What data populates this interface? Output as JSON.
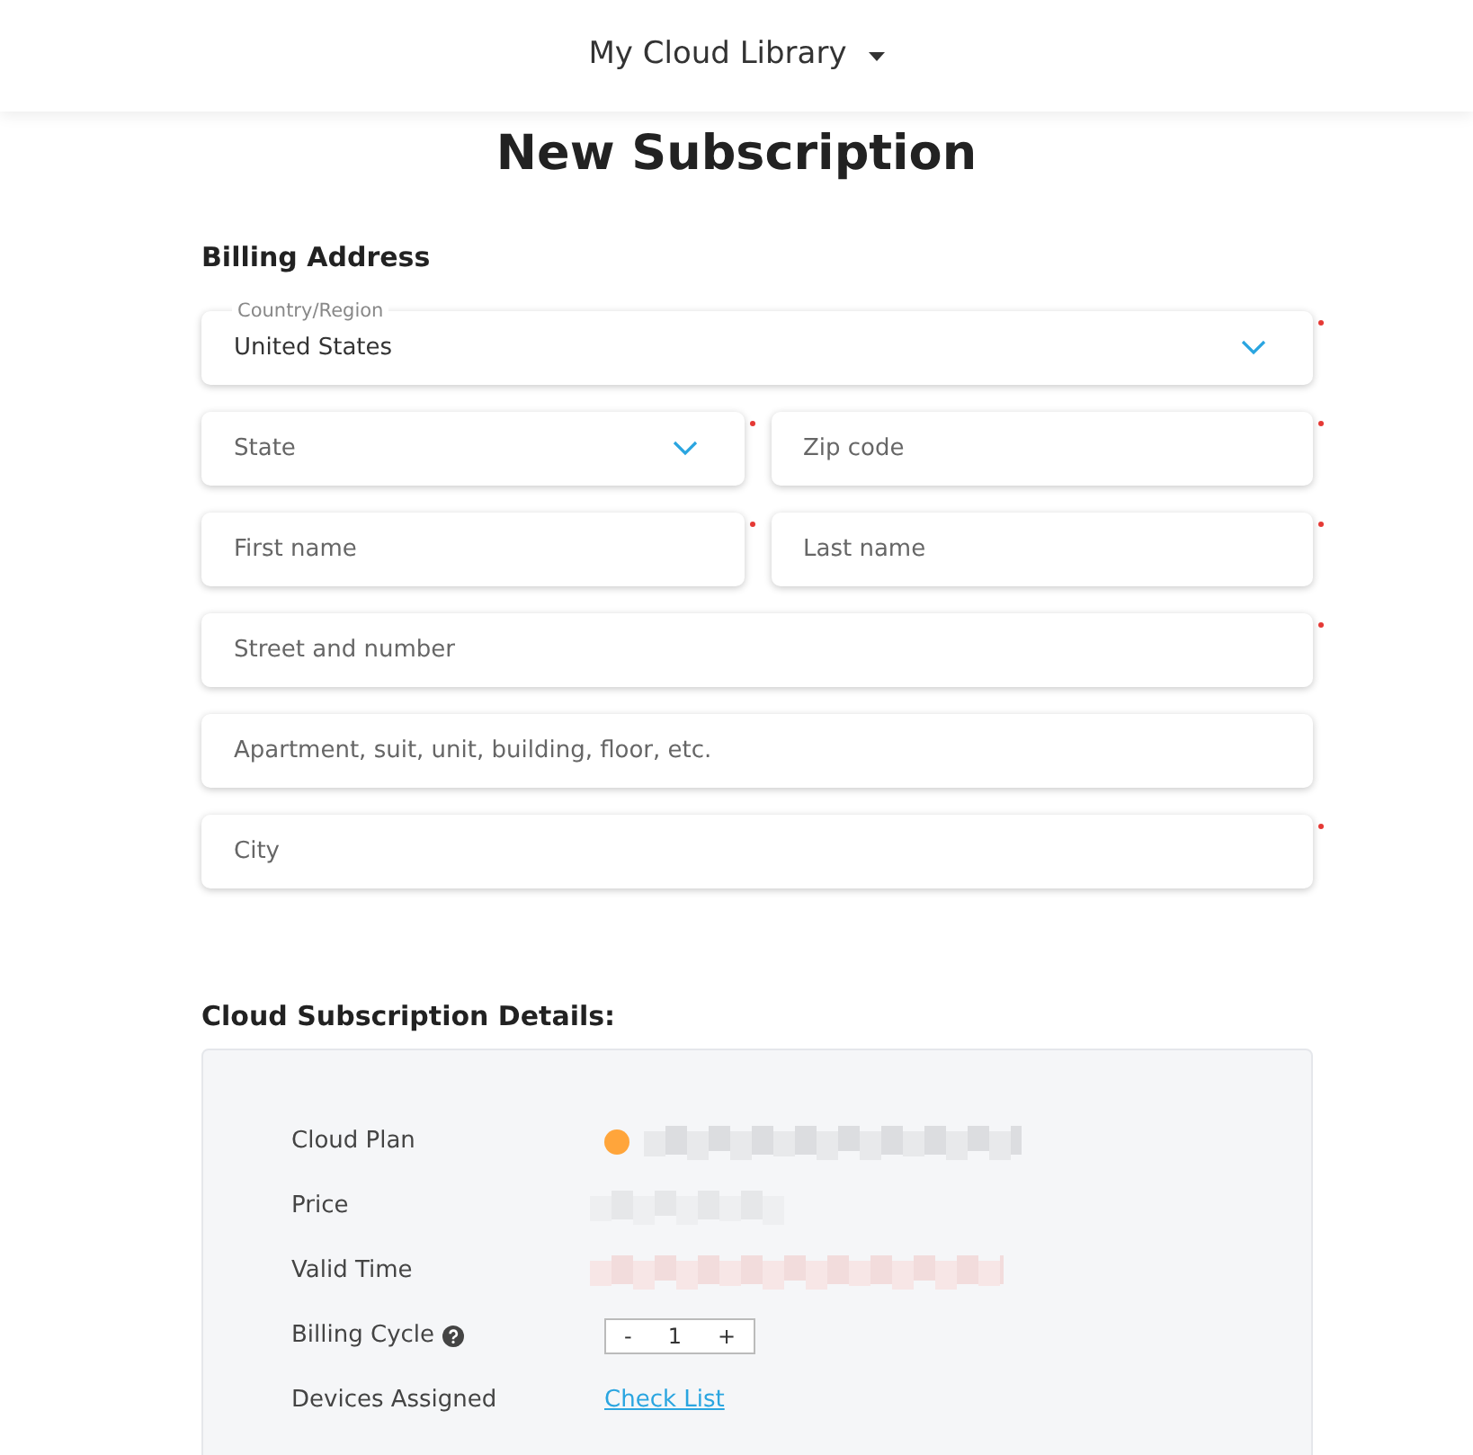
{
  "header": {
    "title": "My Cloud Library"
  },
  "page_title": "New Subscription",
  "billing_address": {
    "heading": "Billing Address",
    "rows": [
      [
        {
          "kind": "select",
          "label": "Country/Region",
          "value": "United States",
          "required": true
        }
      ],
      [
        {
          "kind": "select",
          "placeholder": "State",
          "required": true
        },
        {
          "kind": "input",
          "placeholder": "Zip code",
          "required": true
        }
      ],
      [
        {
          "kind": "input",
          "placeholder": "First name",
          "required": true
        },
        {
          "kind": "input",
          "placeholder": "Last name",
          "required": true
        }
      ],
      [
        {
          "kind": "input",
          "placeholder": "Street and number",
          "required": true
        }
      ],
      [
        {
          "kind": "input",
          "placeholder": "Apartment, suit, unit, building, floor, etc.",
          "required": false
        }
      ],
      [
        {
          "kind": "input",
          "placeholder": "City",
          "required": true
        }
      ]
    ]
  },
  "details": {
    "heading": "Cloud Subscription Details:",
    "rows": [
      {
        "kind": "plan",
        "label": "Cloud Plan",
        "color": "#ffa53b"
      },
      {
        "kind": "blurred",
        "label": "Price"
      },
      {
        "kind": "blurred",
        "label": "Valid Time"
      },
      {
        "kind": "stepper",
        "label": "Billing Cycle",
        "minus": "-",
        "value": "1",
        "plus": "+"
      },
      {
        "kind": "link",
        "label": "Devices Assigned",
        "link": "Check List"
      }
    ]
  }
}
